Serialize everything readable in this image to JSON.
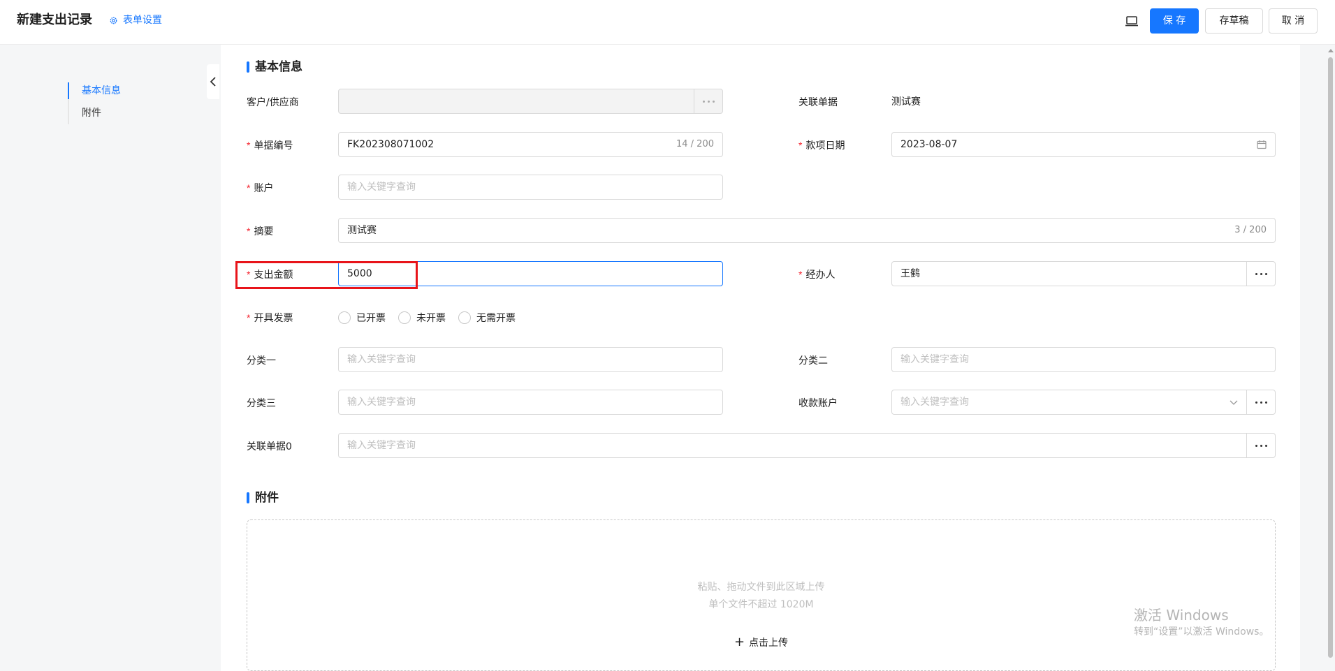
{
  "header": {
    "title": "新建支出记录",
    "form_settings": "表单设置",
    "save": "保 存",
    "save_draft": "存草稿",
    "cancel": "取 消"
  },
  "nav": {
    "items": [
      {
        "label": "基本信息"
      },
      {
        "label": "附件"
      }
    ]
  },
  "basic_info": {
    "title": "基本信息",
    "customer": {
      "label": "客户/供应商",
      "value": ""
    },
    "related_doc": {
      "label": "关联单据",
      "value": "测试赛"
    },
    "doc_no": {
      "label": "单据编号",
      "value": "FK202308071002",
      "count": "14 / 200"
    },
    "pay_date": {
      "label": "款项日期",
      "value": "2023-08-07"
    },
    "account": {
      "label": "账户",
      "placeholder": "输入关键字查询"
    },
    "summary": {
      "label": "摘要",
      "value": "测试赛",
      "count": "3 / 200"
    },
    "amount": {
      "label": "支出金额",
      "value": "5000"
    },
    "handler": {
      "label": "经办人",
      "value": "王鹤"
    },
    "invoice": {
      "label": "开具发票",
      "options": [
        "已开票",
        "未开票",
        "无需开票"
      ]
    },
    "cat1": {
      "label": "分类一",
      "placeholder": "输入关键字查询"
    },
    "cat2": {
      "label": "分类二",
      "placeholder": "输入关键字查询"
    },
    "cat3": {
      "label": "分类三",
      "placeholder": "输入关键字查询"
    },
    "receive_account": {
      "label": "收款账户",
      "placeholder": "输入关键字查询"
    },
    "related_doc0": {
      "label": "关联单据0",
      "placeholder": "输入关键字查询"
    }
  },
  "attachments": {
    "title": "附件",
    "hint1": "粘贴、拖动文件到此区域上传",
    "hint2": "单个文件不超过 1020M",
    "upload": "点击上传"
  },
  "watermark": {
    "line1": "激活 Windows",
    "line2": "转到“设置”以激活 Windows。"
  },
  "colors": {
    "primary": "#1677ff",
    "required": "#f5222d",
    "highlight": "#e8141a"
  }
}
